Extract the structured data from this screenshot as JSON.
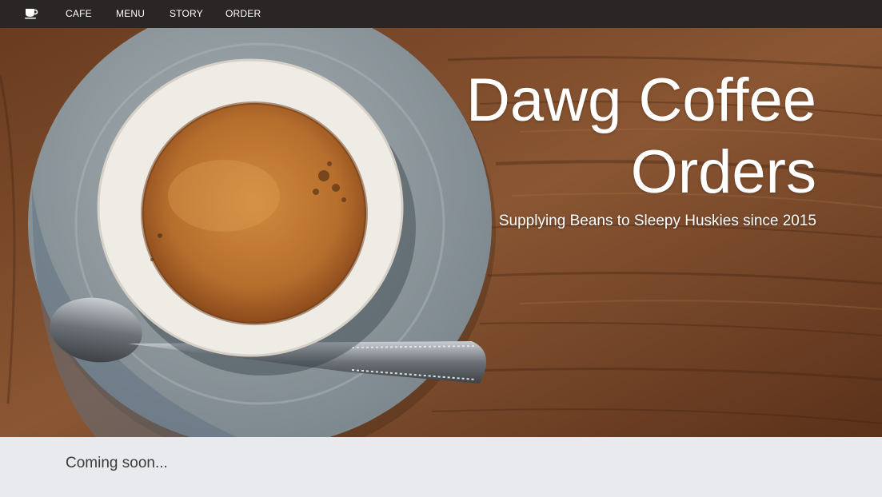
{
  "nav": {
    "logo_icon": "coffee-cup-icon",
    "items": [
      {
        "label": "CAFE"
      },
      {
        "label": "MENU"
      },
      {
        "label": "STORY"
      },
      {
        "label": "ORDER"
      }
    ]
  },
  "hero": {
    "title_line1": "Dawg Coffee",
    "title_line2": "Orders",
    "subtitle": "Supplying Beans to Sleepy Huskies since 2015",
    "image_subject": "espresso cup on saucer with spoon on wooden table"
  },
  "content": {
    "text": "Coming soon..."
  },
  "colors": {
    "navbar": "#2b2626",
    "content_bg": "#e9eaed",
    "text": "#3b3b3b",
    "wood": "#7a4a2a",
    "saucer": "#8f9aa0",
    "espresso": "#c07a35"
  }
}
